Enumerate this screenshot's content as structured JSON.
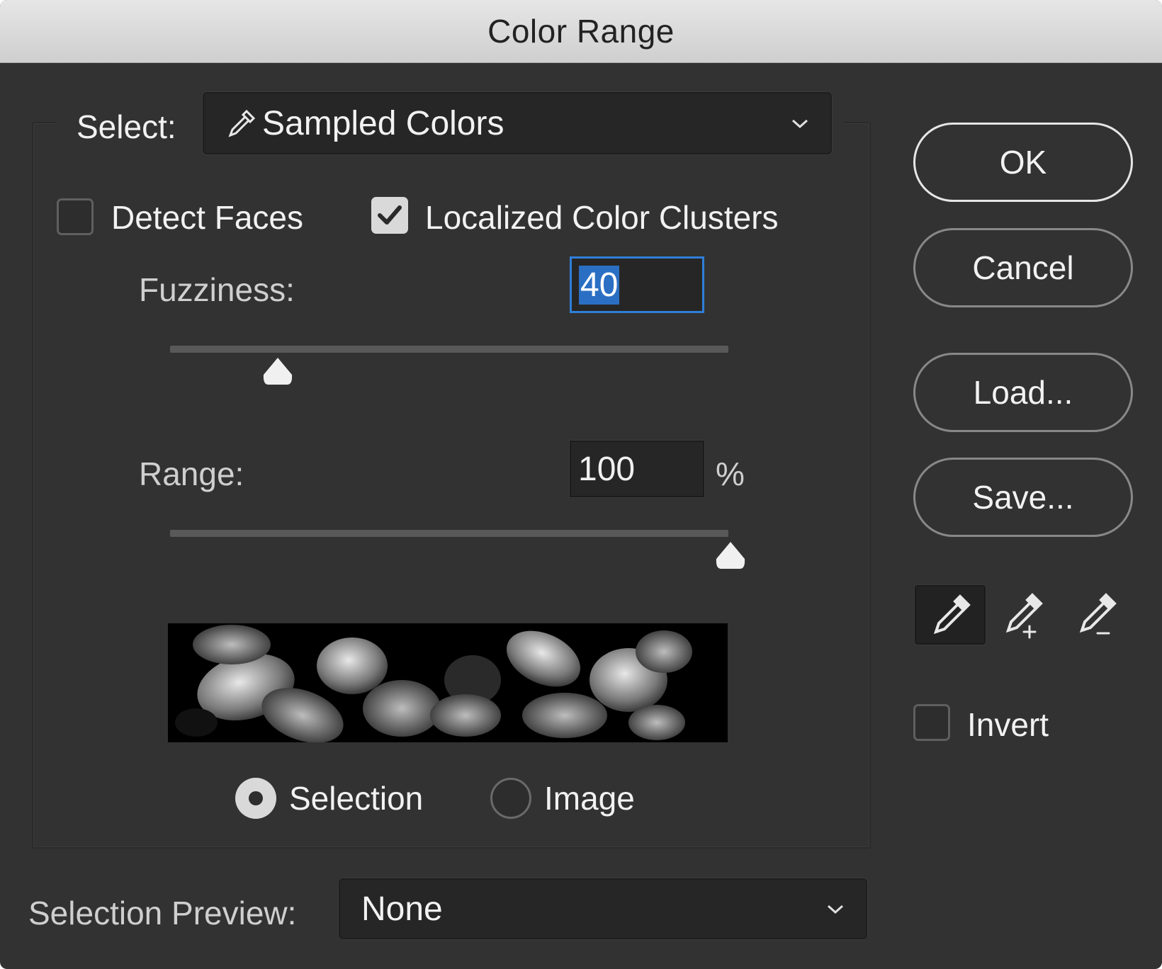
{
  "window": {
    "title": "Color Range"
  },
  "select": {
    "label": "Select:",
    "value": "Sampled Colors",
    "icon": "eyedropper-icon"
  },
  "options": {
    "detect_faces": {
      "label": "Detect Faces",
      "checked": false
    },
    "localized_clusters": {
      "label": "Localized Color Clusters",
      "checked": true
    }
  },
  "fuzziness": {
    "label": "Fuzziness:",
    "value": "40",
    "slider_percent": 20
  },
  "range": {
    "label": "Range:",
    "value": "100",
    "unit": "%",
    "slider_percent": 100
  },
  "view": {
    "selection_label": "Selection",
    "image_label": "Image",
    "selected": "Selection"
  },
  "selection_preview": {
    "label": "Selection Preview:",
    "value": "None"
  },
  "buttons": {
    "ok": "OK",
    "cancel": "Cancel",
    "load": "Load...",
    "save": "Save..."
  },
  "tools": [
    "eyedropper-icon",
    "eyedropper-plus-icon",
    "eyedropper-minus-icon"
  ],
  "invert": {
    "label": "Invert",
    "checked": false
  },
  "colors": {
    "background": "#323232",
    "focus": "#2f7fd8",
    "titlebar": "#d9d9d9"
  }
}
